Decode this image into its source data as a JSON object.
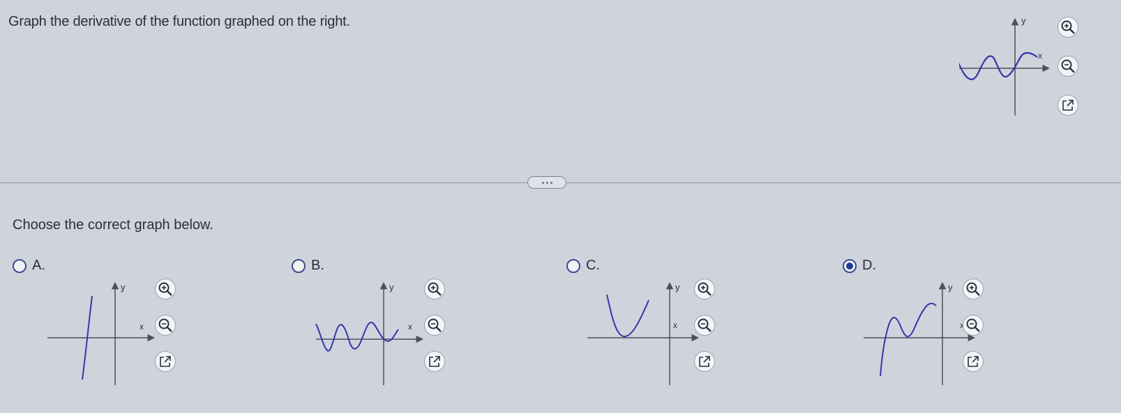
{
  "question": "Graph the derivative of the function graphed on the right.",
  "prompt": "Choose the correct graph below.",
  "axis_labels": {
    "x": "x",
    "y": "y"
  },
  "options": [
    {
      "letter": "A.",
      "selected": false
    },
    {
      "letter": "B.",
      "selected": false
    },
    {
      "letter": "C.",
      "selected": false
    },
    {
      "letter": "D.",
      "selected": true
    }
  ],
  "icons": {
    "zoom_in": "zoom-in-icon",
    "zoom_out": "zoom-out-icon",
    "open_new": "external-link-icon",
    "more": "ellipsis-icon"
  },
  "colors": {
    "curve": "#3636a8",
    "axis": "#4a4f5a",
    "accent": "#1f3a94"
  }
}
